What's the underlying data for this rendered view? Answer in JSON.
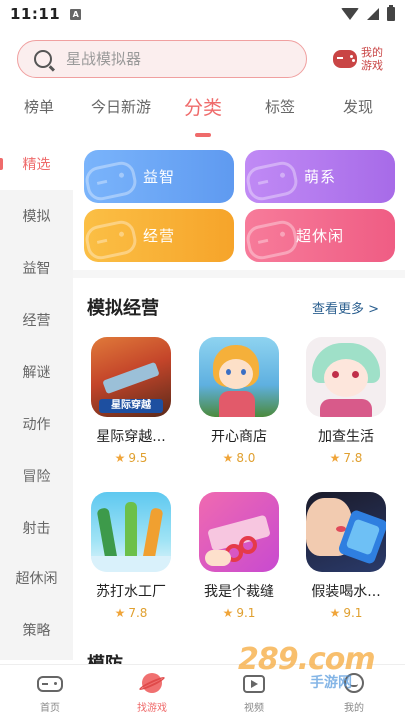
{
  "status_bar": {
    "time": "11:11",
    "notification_glyph": "A"
  },
  "search": {
    "placeholder": "星战模拟器"
  },
  "my_games": {
    "label": "我的游戏"
  },
  "top_tabs": [
    {
      "label": "榜单"
    },
    {
      "label": "今日新游"
    },
    {
      "label": "分类",
      "active": true
    },
    {
      "label": "标签"
    },
    {
      "label": "发现"
    }
  ],
  "side_menu": [
    {
      "label": "精选",
      "active": true
    },
    {
      "label": "模拟"
    },
    {
      "label": "益智"
    },
    {
      "label": "经营"
    },
    {
      "label": "解谜"
    },
    {
      "label": "动作"
    },
    {
      "label": "冒险"
    },
    {
      "label": "射击"
    },
    {
      "label": "超休闲"
    },
    {
      "label": "策略"
    }
  ],
  "category_cards": [
    {
      "label": "益智",
      "color": "#6aa6f5"
    },
    {
      "label": "萌系",
      "color": "#b57af0"
    },
    {
      "label": "经营",
      "color": "#f8b034"
    },
    {
      "label": "超休闲",
      "color": "#f36b8e"
    }
  ],
  "section": {
    "title": "模拟经营",
    "see_more": "查看更多 >",
    "games": [
      {
        "name": "星际穿越...",
        "rating": "9.5",
        "icon_text": "星际穿越"
      },
      {
        "name": "开心商店",
        "rating": "8.0"
      },
      {
        "name": "加查生活",
        "rating": "7.8"
      },
      {
        "name": "苏打水工厂",
        "rating": "7.8"
      },
      {
        "name": "我是个裁缝",
        "rating": "9.1"
      },
      {
        "name": "假装喝水...",
        "rating": "9.1"
      }
    ]
  },
  "next_section": {
    "title": "模防"
  },
  "bottom_nav": [
    {
      "label": "首页"
    },
    {
      "label": "找游戏",
      "active": true
    },
    {
      "label": "视频"
    },
    {
      "label": "我的"
    }
  ],
  "watermark": {
    "text": "289.com",
    "subtext": "手游网"
  },
  "colors": {
    "accent": "#ef6b6b",
    "link": "#2b5f8f",
    "rating": "#f0a53a"
  }
}
